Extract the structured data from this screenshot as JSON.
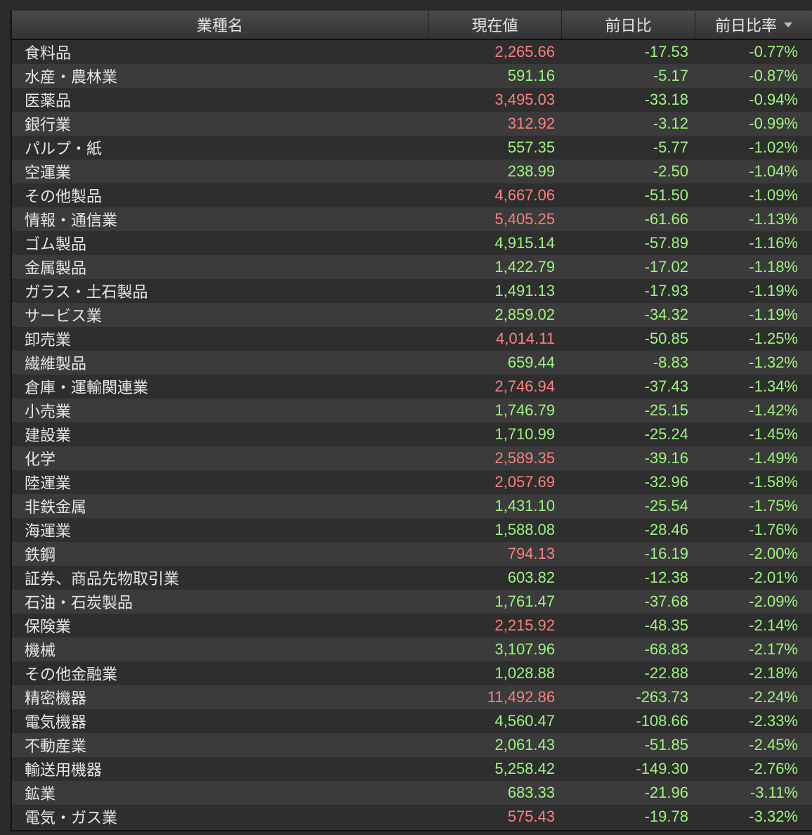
{
  "colors": {
    "up": "#9ef57d",
    "down": "#ff7f7f",
    "text": "#e6e6e6"
  },
  "headers": {
    "name": "業種名",
    "price": "現在値",
    "change": "前日比",
    "change_pct": "前日比率"
  },
  "sort_icon": "sort-descending-icon",
  "rows": [
    {
      "name": "食料品",
      "price": "2,265.66",
      "change": "-17.53",
      "pct": "-0.77%",
      "price_color": "red"
    },
    {
      "name": "水産・農林業",
      "price": "591.16",
      "change": "-5.17",
      "pct": "-0.87%",
      "price_color": "green"
    },
    {
      "name": "医薬品",
      "price": "3,495.03",
      "change": "-33.18",
      "pct": "-0.94%",
      "price_color": "red"
    },
    {
      "name": "銀行業",
      "price": "312.92",
      "change": "-3.12",
      "pct": "-0.99%",
      "price_color": "red"
    },
    {
      "name": "パルプ・紙",
      "price": "557.35",
      "change": "-5.77",
      "pct": "-1.02%",
      "price_color": "green"
    },
    {
      "name": "空運業",
      "price": "238.99",
      "change": "-2.50",
      "pct": "-1.04%",
      "price_color": "green"
    },
    {
      "name": "その他製品",
      "price": "4,667.06",
      "change": "-51.50",
      "pct": "-1.09%",
      "price_color": "red"
    },
    {
      "name": "情報・通信業",
      "price": "5,405.25",
      "change": "-61.66",
      "pct": "-1.13%",
      "price_color": "red"
    },
    {
      "name": "ゴム製品",
      "price": "4,915.14",
      "change": "-57.89",
      "pct": "-1.16%",
      "price_color": "green"
    },
    {
      "name": "金属製品",
      "price": "1,422.79",
      "change": "-17.02",
      "pct": "-1.18%",
      "price_color": "green"
    },
    {
      "name": "ガラス・土石製品",
      "price": "1,491.13",
      "change": "-17.93",
      "pct": "-1.19%",
      "price_color": "green"
    },
    {
      "name": "サービス業",
      "price": "2,859.02",
      "change": "-34.32",
      "pct": "-1.19%",
      "price_color": "green"
    },
    {
      "name": "卸売業",
      "price": "4,014.11",
      "change": "-50.85",
      "pct": "-1.25%",
      "price_color": "red"
    },
    {
      "name": "繊維製品",
      "price": "659.44",
      "change": "-8.83",
      "pct": "-1.32%",
      "price_color": "green"
    },
    {
      "name": "倉庫・運輸関連業",
      "price": "2,746.94",
      "change": "-37.43",
      "pct": "-1.34%",
      "price_color": "red"
    },
    {
      "name": "小売業",
      "price": "1,746.79",
      "change": "-25.15",
      "pct": "-1.42%",
      "price_color": "green"
    },
    {
      "name": "建設業",
      "price": "1,710.99",
      "change": "-25.24",
      "pct": "-1.45%",
      "price_color": "green"
    },
    {
      "name": "化学",
      "price": "2,589.35",
      "change": "-39.16",
      "pct": "-1.49%",
      "price_color": "red"
    },
    {
      "name": "陸運業",
      "price": "2,057.69",
      "change": "-32.96",
      "pct": "-1.58%",
      "price_color": "red"
    },
    {
      "name": "非鉄金属",
      "price": "1,431.10",
      "change": "-25.54",
      "pct": "-1.75%",
      "price_color": "green"
    },
    {
      "name": "海運業",
      "price": "1,588.08",
      "change": "-28.46",
      "pct": "-1.76%",
      "price_color": "green"
    },
    {
      "name": "鉄鋼",
      "price": "794.13",
      "change": "-16.19",
      "pct": "-2.00%",
      "price_color": "red"
    },
    {
      "name": "証券、商品先物取引業",
      "price": "603.82",
      "change": "-12.38",
      "pct": "-2.01%",
      "price_color": "green"
    },
    {
      "name": "石油・石炭製品",
      "price": "1,761.47",
      "change": "-37.68",
      "pct": "-2.09%",
      "price_color": "green"
    },
    {
      "name": "保険業",
      "price": "2,215.92",
      "change": "-48.35",
      "pct": "-2.14%",
      "price_color": "red"
    },
    {
      "name": "機械",
      "price": "3,107.96",
      "change": "-68.83",
      "pct": "-2.17%",
      "price_color": "green"
    },
    {
      "name": "その他金融業",
      "price": "1,028.88",
      "change": "-22.88",
      "pct": "-2.18%",
      "price_color": "green"
    },
    {
      "name": "精密機器",
      "price": "11,492.86",
      "change": "-263.73",
      "pct": "-2.24%",
      "price_color": "red"
    },
    {
      "name": "電気機器",
      "price": "4,560.47",
      "change": "-108.66",
      "pct": "-2.33%",
      "price_color": "green"
    },
    {
      "name": "不動産業",
      "price": "2,061.43",
      "change": "-51.85",
      "pct": "-2.45%",
      "price_color": "green"
    },
    {
      "name": "輸送用機器",
      "price": "5,258.42",
      "change": "-149.30",
      "pct": "-2.76%",
      "price_color": "green"
    },
    {
      "name": "鉱業",
      "price": "683.33",
      "change": "-21.96",
      "pct": "-3.11%",
      "price_color": "green"
    },
    {
      "name": "電気・ガス業",
      "price": "575.43",
      "change": "-19.78",
      "pct": "-3.32%",
      "price_color": "red"
    }
  ]
}
